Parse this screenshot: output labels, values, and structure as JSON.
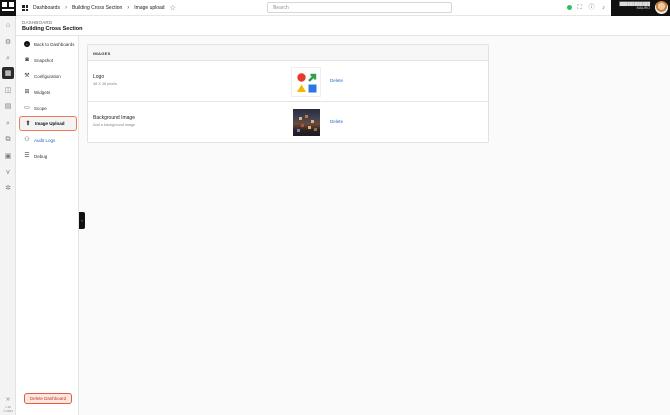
{
  "rail": {
    "icons": [
      "home-icon",
      "gear-icon",
      "search-icon",
      "dashboard-icon",
      "layers-icon",
      "document-icon",
      "query-icon",
      "link-icon",
      "image-icon",
      "filter-icon",
      "settings-icon"
    ],
    "active_index": 3,
    "footer_version": "v 29",
    "footer_year": "© 2024"
  },
  "topbar": {
    "breadcrumb": {
      "dashboards": "Dashboards",
      "current": "Building Cross Section",
      "page": "Image upload"
    },
    "search_placeholder": "Search",
    "user_name_line1": "████████████",
    "user_name_line2": "MAURO",
    "status_color": "#2fbf60"
  },
  "header": {
    "subtitle": "DASHBOARD",
    "title": "Building Cross Section"
  },
  "nav": {
    "back": "Back to Dashboards",
    "items": [
      {
        "label": "Snapshot",
        "icon": "camera-icon"
      },
      {
        "label": "Configuration",
        "icon": "wrench-icon"
      },
      {
        "label": "Widgets",
        "icon": "widgets-icon"
      },
      {
        "label": "Scope",
        "icon": "scope-icon"
      },
      {
        "label": "Image Upload",
        "icon": "user-upload-icon"
      },
      {
        "label": "Audit Logs",
        "icon": "user-icon"
      },
      {
        "label": "Debug",
        "icon": "debug-icon"
      }
    ],
    "selected_index": 4,
    "delete_button": "Delete Dashboard"
  },
  "images": {
    "header": "IMAGES",
    "rows": [
      {
        "title": "Logo",
        "subtitle": "48 X 48 pixels",
        "action": "Delete"
      },
      {
        "title": "Background Image",
        "subtitle": "Add a background image",
        "action": "Delete"
      }
    ]
  },
  "colors": {
    "accent": "#f07a55",
    "link": "#2d64c8",
    "danger": "#e85b3a"
  }
}
